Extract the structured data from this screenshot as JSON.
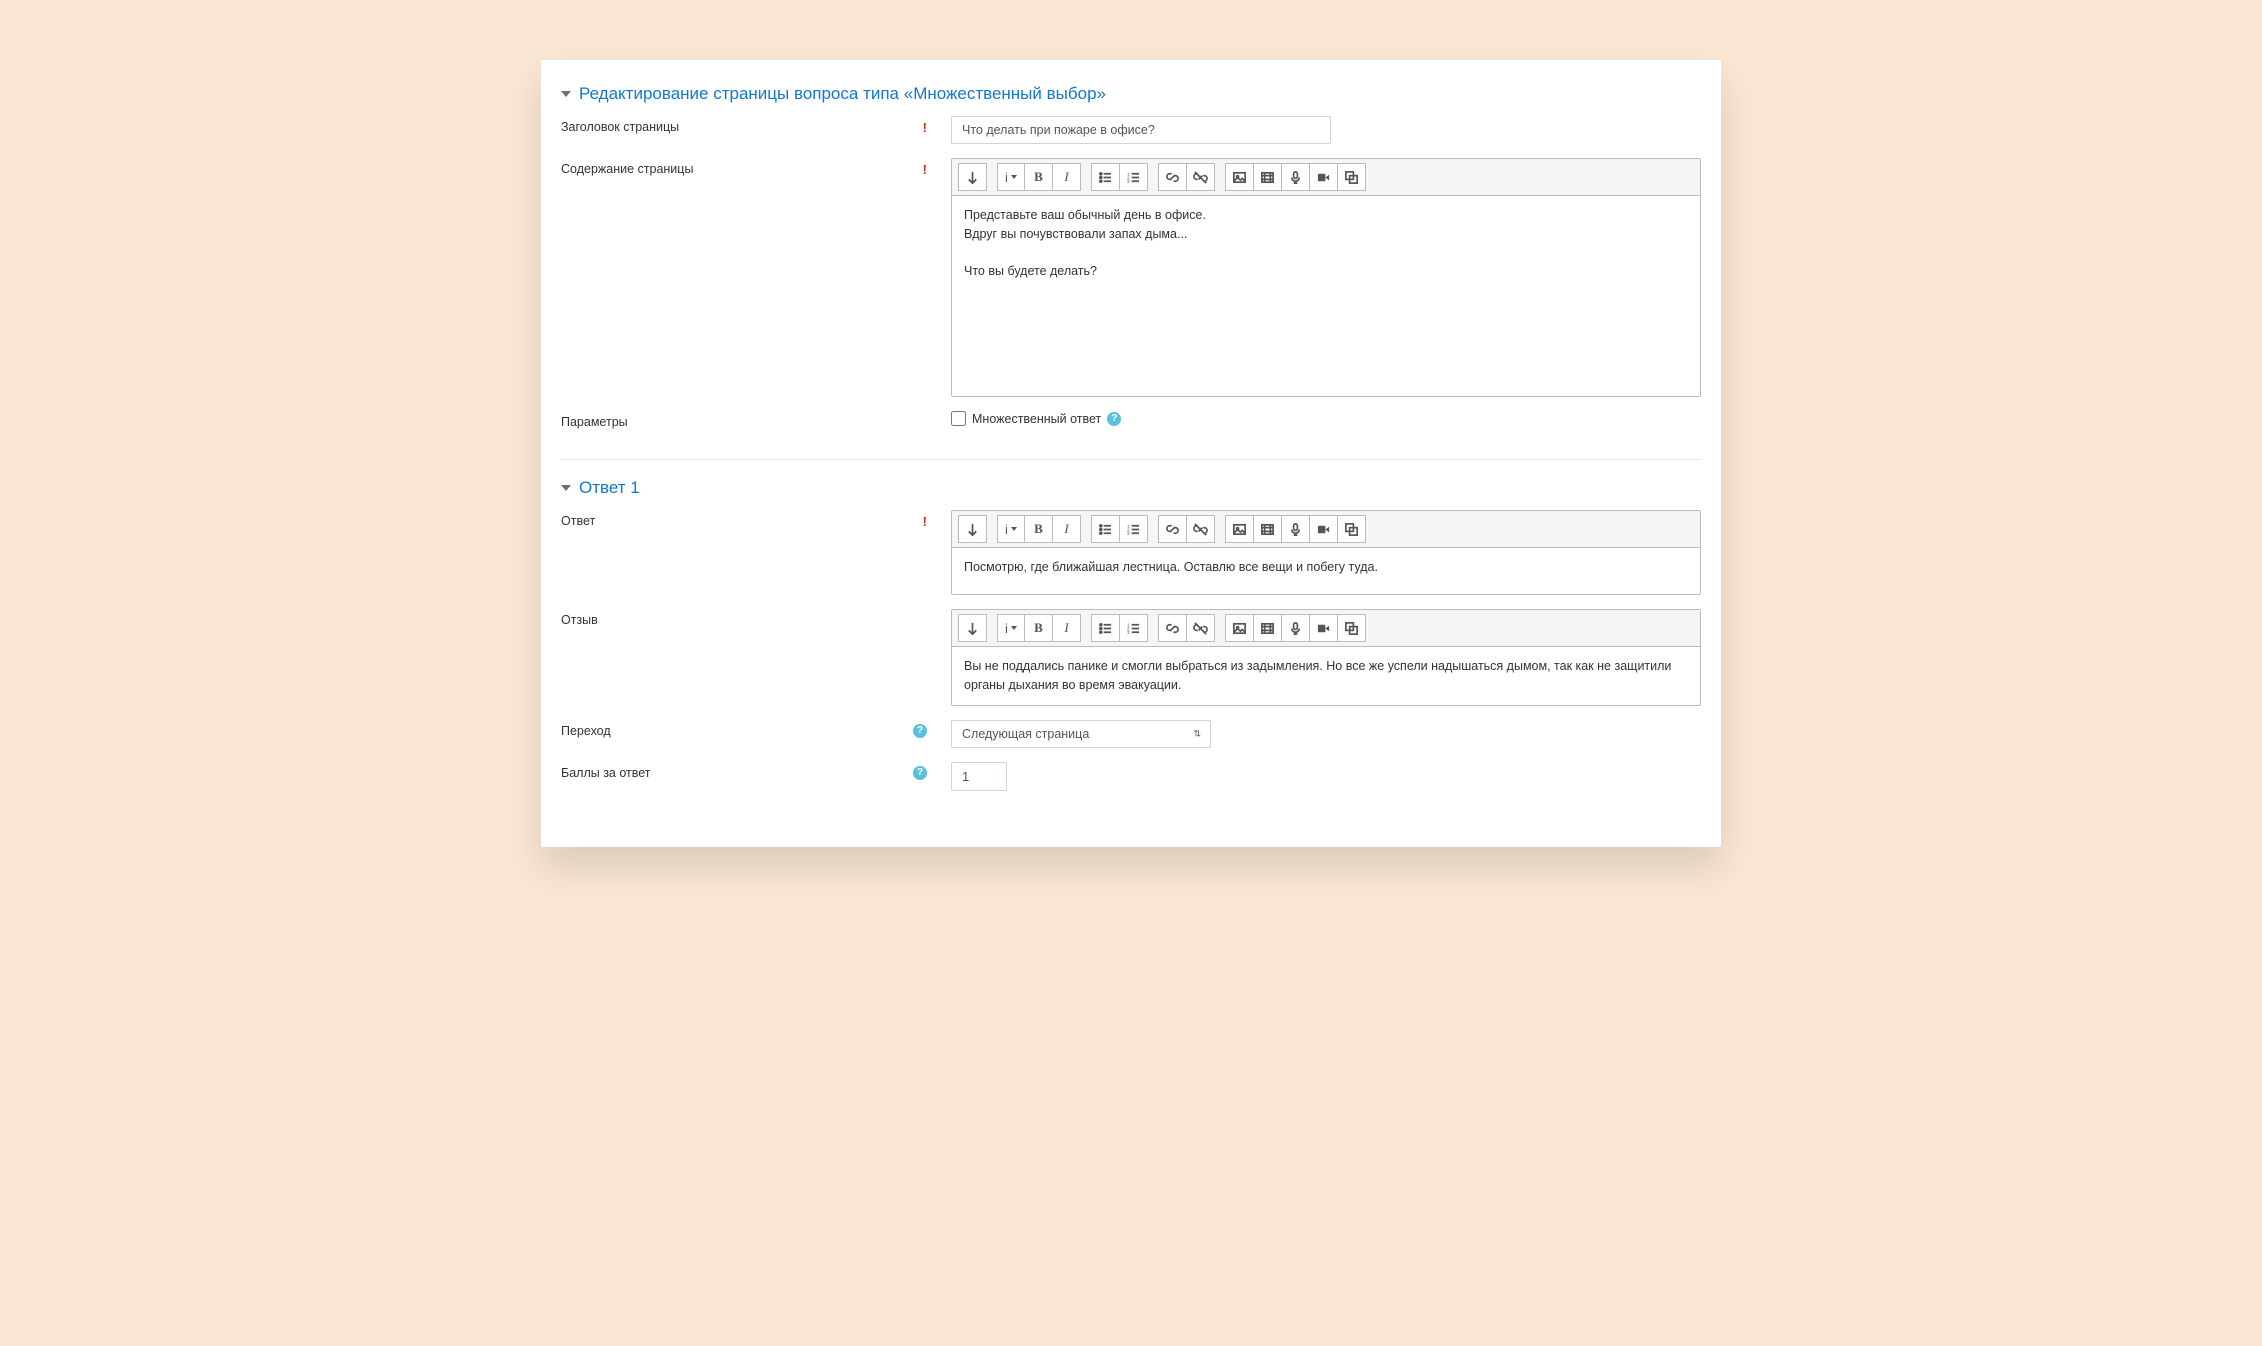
{
  "section1": {
    "title": "Редактирование страницы вопроса типа «Множественный выбор»",
    "page_title_label": "Заголовок страницы",
    "page_title_value": "Что делать при пожаре в офисе?",
    "page_content_label": "Содержание страницы",
    "page_content_value": "Представьте ваш обычный день в офисе.\nВдруг вы почувствовали запах дыма...\n\nЧто вы будете делать?",
    "options_label": "Параметры",
    "multi_answer_label": "Множественный ответ"
  },
  "section2": {
    "title": "Ответ 1",
    "answer_label": "Ответ",
    "answer_value": "Посмотрю, где ближайшая лестница. Оставлю все вещи и побегу туда.",
    "feedback_label": "Отзыв",
    "feedback_value": "Вы не поддались панике и смогли выбраться из задымления. Но все же успели надышаться дымом, так как не защитили органы дыхания во время эвакуации.",
    "jump_label": "Переход",
    "jump_selected": "Следующая страница",
    "score_label": "Баллы за ответ",
    "score_value": "1"
  }
}
